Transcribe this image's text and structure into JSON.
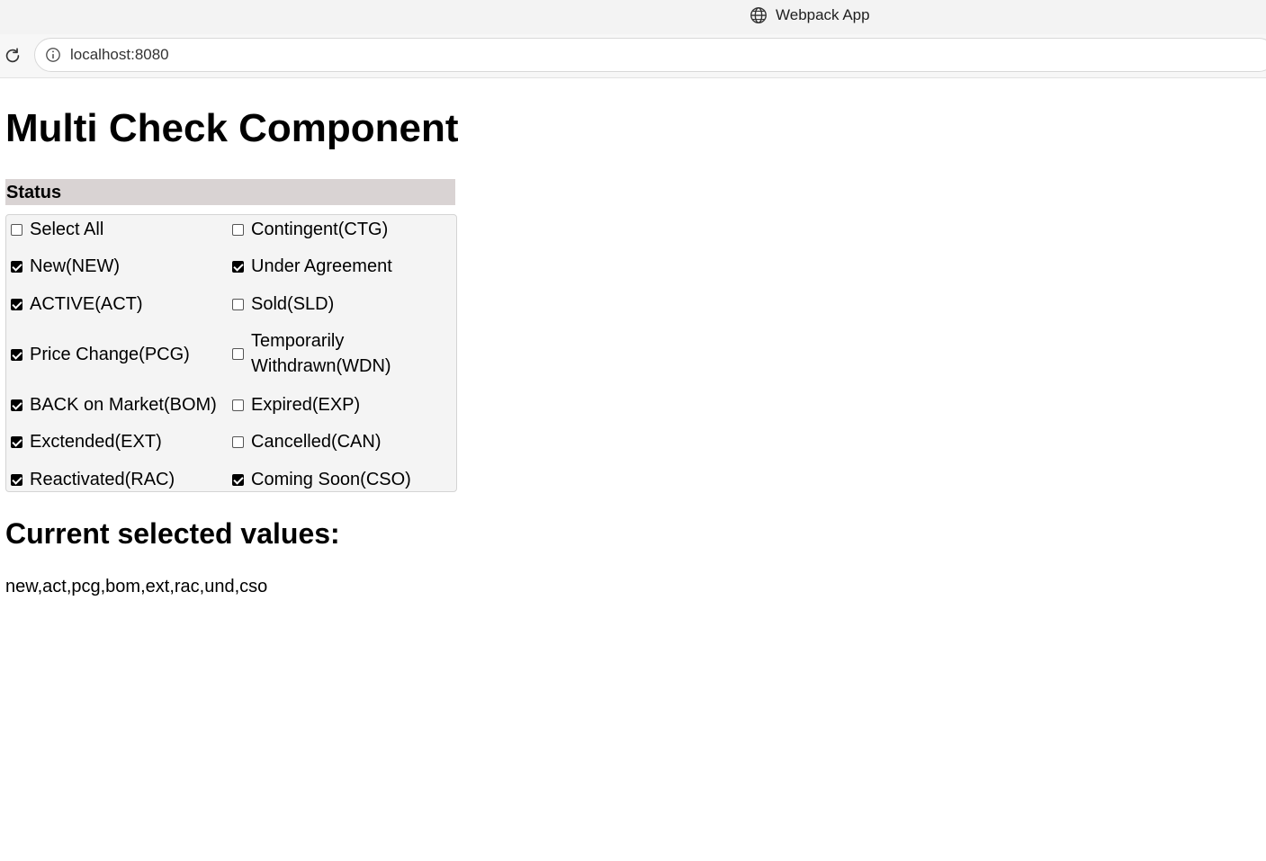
{
  "browser": {
    "tab_title": "Webpack App",
    "url": "localhost:8080"
  },
  "page": {
    "title": "Multi Check Component",
    "status_label": "Status",
    "checkboxes": [
      {
        "label": "Select All",
        "checked": false
      },
      {
        "label": "Contingent(CTG)",
        "checked": false
      },
      {
        "label": "New(NEW)",
        "checked": true
      },
      {
        "label": "Under Agreement",
        "checked": true
      },
      {
        "label": "ACTIVE(ACT)",
        "checked": true
      },
      {
        "label": "Sold(SLD)",
        "checked": false
      },
      {
        "label": "Price Change(PCG)",
        "checked": true
      },
      {
        "label": "Temporarily Withdrawn(WDN)",
        "label_line1": "Temporarily",
        "label_line2": "Withdrawn(WDN)",
        "checked": false
      },
      {
        "label": "BACK on Market(BOM)",
        "checked": true
      },
      {
        "label": "Expired(EXP)",
        "checked": false
      },
      {
        "label": "Exctended(EXT)",
        "checked": true
      },
      {
        "label": "Cancelled(CAN)",
        "checked": false
      },
      {
        "label": "Reactivated(RAC)",
        "checked": true
      },
      {
        "label": "Coming Soon(CSO)",
        "checked": true
      }
    ],
    "selected_heading": "Current selected values:",
    "selected_values": "new,act,pcg,bom,ext,rac,und,cso"
  },
  "colors": {
    "status_header_bg": "#d9d3d3",
    "panel_bg": "#f4f4f4"
  }
}
